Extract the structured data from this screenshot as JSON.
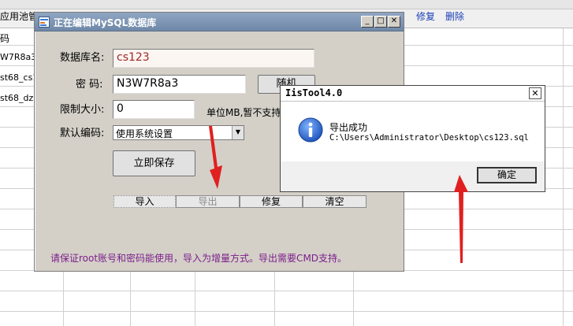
{
  "background": {
    "title": "应用池管理(3)",
    "links": {
      "repair": "修复",
      "delete": "删除"
    },
    "column_header": "码",
    "rows": [
      "W7R8a3",
      "st68_cs1",
      "st68_dz"
    ]
  },
  "edit_window": {
    "title": "正在编辑MySQL数据库",
    "db_name_label": "数据库名:",
    "db_name_value": "cs123",
    "password_label": "密 码:",
    "password_value": "N3W7R8a3",
    "random_button": "随机",
    "limit_label": "限制大小:",
    "limit_value": "0",
    "limit_unit": "单位MB,暂不支持",
    "encoding_label": "默认编码:",
    "encoding_value": "使用系统设置",
    "save_button": "立即保存",
    "tabs": [
      "导入",
      "导出",
      "修复",
      "清空"
    ],
    "note": "请保证root账号和密码能使用，导入为增量方式。导出需要CMD支持。"
  },
  "dialog": {
    "title": "IisTool4.0",
    "message": "导出成功",
    "path": "C:\\Users\\Administrator\\Desktop\\cs123.sql",
    "ok_button": "确定"
  },
  "colors": {
    "arrow": "#e02020",
    "note_text": "#7c1e8c",
    "titlebar": "#7f97b6",
    "link": "#1a3fb5"
  }
}
